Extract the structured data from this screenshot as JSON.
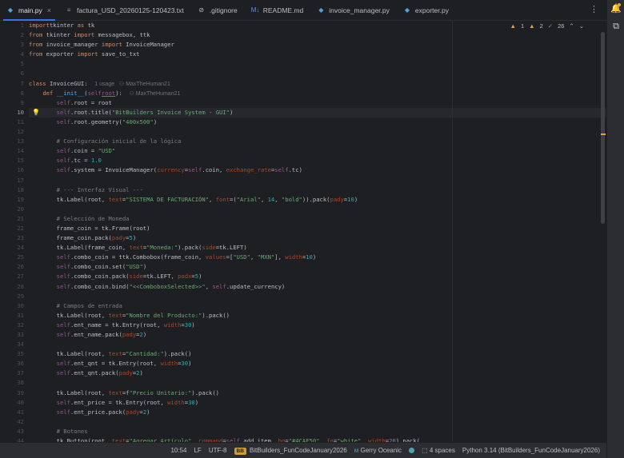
{
  "tabs": [
    {
      "icon": "python-file-icon",
      "glyph": "◆",
      "color": "#4aa3e0",
      "label": "main.py",
      "active": true,
      "closable": true
    },
    {
      "icon": "text-file-icon",
      "glyph": "≡",
      "color": "#8c8f94",
      "label": "factura_USD_20260125-120423.txt",
      "active": false,
      "closable": false
    },
    {
      "icon": "gitignore-icon",
      "glyph": "⊘",
      "color": "#bcbec4",
      "label": ".gitignore",
      "active": false,
      "closable": false
    },
    {
      "icon": "markdown-file-icon",
      "glyph": "M↓",
      "color": "#5b8ef0",
      "label": "README.md",
      "active": false,
      "closable": false
    },
    {
      "icon": "python-file-icon",
      "glyph": "◆",
      "color": "#4aa3e0",
      "label": "invoice_manager.py",
      "active": false,
      "closable": false
    },
    {
      "icon": "python-file-icon",
      "glyph": "◆",
      "color": "#4aa3e0",
      "label": "exporter.py",
      "active": false,
      "closable": false
    }
  ],
  "inspection": {
    "warnings": "1",
    "weak_warnings": "2",
    "ok": "26"
  },
  "current_line": 10,
  "code_lines": [
    [
      [
        "kw",
        "import"
      ],
      [
        "",
        "tkinter "
      ],
      [
        "kw",
        "as"
      ],
      [
        "",
        " tk"
      ]
    ],
    [
      [
        "kw",
        "from"
      ],
      [
        "",
        " tkinter "
      ],
      [
        "kw",
        "import"
      ],
      [
        "",
        " messagebox, ttk"
      ]
    ],
    [
      [
        "kw",
        "from"
      ],
      [
        "",
        " invoice_manager "
      ],
      [
        "kw",
        "import"
      ],
      [
        "",
        " InvoiceManager"
      ]
    ],
    [
      [
        "kw",
        "from"
      ],
      [
        "",
        " exporter "
      ],
      [
        "kw",
        "import"
      ],
      [
        "",
        " save_to_txt"
      ]
    ],
    [],
    [],
    [
      [
        "kw",
        "class"
      ],
      [
        "",
        " InvoiceGUI:  "
      ],
      [
        "hint",
        "1 usage   ⚇ MaxTheHuman21"
      ]
    ],
    [
      [
        "",
        "    "
      ],
      [
        "kw",
        "def"
      ],
      [
        "",
        " "
      ],
      [
        "fn",
        "__init__"
      ],
      [
        "",
        "("
      ],
      [
        "sf",
        "self"
      ],
      [
        ", "
      ],
      [
        "sf under",
        "root"
      ],
      [
        "",
        "):  "
      ],
      [
        "hint",
        "⚇ MaxTheHuman21"
      ]
    ],
    [
      [
        "",
        "        "
      ],
      [
        "sf",
        "self"
      ],
      [
        "",
        ".root = root"
      ]
    ],
    [
      [
        "",
        "        "
      ],
      [
        "sf",
        "self"
      ],
      [
        "",
        ".root.title("
      ],
      [
        "str",
        "\"BitBuilders Invoice System - GUI\""
      ],
      [
        "",
        ")"
      ]
    ],
    [
      [
        "",
        "        "
      ],
      [
        "sf",
        "self"
      ],
      [
        "",
        ".root.geometry("
      ],
      [
        "str",
        "\"400x500\""
      ],
      [
        "",
        ")"
      ]
    ],
    [],
    [
      [
        "",
        "        "
      ],
      [
        "cm",
        "# Configuración inicial de la lógica"
      ]
    ],
    [
      [
        "",
        "        "
      ],
      [
        "sf",
        "self"
      ],
      [
        "",
        ".coin = "
      ],
      [
        "str",
        "\"USD\""
      ]
    ],
    [
      [
        "",
        "        "
      ],
      [
        "sf",
        "self"
      ],
      [
        "",
        ".tc = "
      ],
      [
        "num",
        "1.0"
      ]
    ],
    [
      [
        "",
        "        "
      ],
      [
        "sf",
        "self"
      ],
      [
        "",
        ".system = InvoiceManager("
      ],
      [
        "kwarg",
        "currency"
      ],
      [
        "",
        "="
      ],
      [
        "sf",
        "self"
      ],
      [
        "",
        ".coin, "
      ],
      [
        "kwarg",
        "exchange_rate"
      ],
      [
        "",
        "="
      ],
      [
        "sf",
        "self"
      ],
      [
        "",
        ".tc)"
      ]
    ],
    [],
    [
      [
        "",
        "        "
      ],
      [
        "cm",
        "# --- Interfaz Visual ---"
      ]
    ],
    [
      [
        "",
        "        tk.Label(root, "
      ],
      [
        "kwarg",
        "text"
      ],
      [
        "",
        "="
      ],
      [
        "str",
        "\"SISTEMA DE FACTURACIÓN\""
      ],
      [
        "",
        ", "
      ],
      [
        "kwarg",
        "font"
      ],
      [
        "",
        "=("
      ],
      [
        "str",
        "\"Arial\""
      ],
      [
        "",
        ", "
      ],
      [
        "num",
        "14"
      ],
      [
        "",
        ", "
      ],
      [
        "str",
        "\"bold\""
      ],
      [
        "",
        "))"
      ],
      [
        "",
        ".pack("
      ],
      [
        "kwarg",
        "pady"
      ],
      [
        "",
        "="
      ],
      [
        "num",
        "10"
      ],
      [
        "",
        ")"
      ]
    ],
    [],
    [
      [
        "",
        "        "
      ],
      [
        "cm",
        "# Selección de Moneda"
      ]
    ],
    [
      [
        "",
        "        frame_coin = tk.Frame(root)"
      ]
    ],
    [
      [
        "",
        "        frame_coin.pack("
      ],
      [
        "kwarg",
        "pady"
      ],
      [
        "",
        "="
      ],
      [
        "num",
        "5"
      ],
      [
        "",
        ")"
      ]
    ],
    [
      [
        "",
        "        tk.Label(frame_coin, "
      ],
      [
        "kwarg",
        "text"
      ],
      [
        "",
        "="
      ],
      [
        "str",
        "\"Moneda:\""
      ],
      [
        "",
        ").pack("
      ],
      [
        "kwarg",
        "side"
      ],
      [
        "",
        "=tk.LEFT)"
      ]
    ],
    [
      [
        "",
        "        "
      ],
      [
        "sf",
        "self"
      ],
      [
        "",
        ".combo_coin = ttk.Combobox(frame_coin, "
      ],
      [
        "kwarg",
        "values"
      ],
      [
        "",
        "=["
      ],
      [
        "str",
        "\"USD\""
      ],
      [
        "",
        ", "
      ],
      [
        "str",
        "\"MXN\""
      ],
      [
        "",
        "], "
      ],
      [
        "kwarg",
        "width"
      ],
      [
        "",
        "="
      ],
      [
        "num",
        "10"
      ],
      [
        "",
        ")"
      ]
    ],
    [
      [
        "",
        "        "
      ],
      [
        "sf",
        "self"
      ],
      [
        "",
        ".combo_coin.set("
      ],
      [
        "str",
        "\"USD\""
      ],
      [
        "",
        ")"
      ]
    ],
    [
      [
        "",
        "        "
      ],
      [
        "sf",
        "self"
      ],
      [
        "",
        ".combo_coin.pack("
      ],
      [
        "kwarg",
        "side"
      ],
      [
        "",
        "=tk.LEFT, "
      ],
      [
        "kwarg",
        "padx"
      ],
      [
        "",
        "="
      ],
      [
        "num",
        "5"
      ],
      [
        "",
        ")"
      ]
    ],
    [
      [
        "",
        "        "
      ],
      [
        "sf",
        "self"
      ],
      [
        "",
        ".combo_coin.bind("
      ],
      [
        "str",
        "\"<<ComboboxSelected>>\""
      ],
      [
        "",
        ", "
      ],
      [
        "sf",
        "self"
      ],
      [
        "",
        ".update_currency)"
      ]
    ],
    [],
    [
      [
        "",
        "        "
      ],
      [
        "cm",
        "# Campos de entrada"
      ]
    ],
    [
      [
        "",
        "        tk.Label(root, "
      ],
      [
        "kwarg",
        "text"
      ],
      [
        "",
        "="
      ],
      [
        "str",
        "\"Nombre del Producto:\""
      ],
      [
        "",
        ").pack()"
      ]
    ],
    [
      [
        "",
        "        "
      ],
      [
        "sf",
        "self"
      ],
      [
        "",
        ".ent_name = tk.Entry(root, "
      ],
      [
        "kwarg",
        "width"
      ],
      [
        "",
        "="
      ],
      [
        "num",
        "30"
      ],
      [
        "",
        ")"
      ]
    ],
    [
      [
        "",
        "        "
      ],
      [
        "sf",
        "self"
      ],
      [
        "",
        ".ent_name.pack("
      ],
      [
        "kwarg",
        "pady"
      ],
      [
        "",
        "="
      ],
      [
        "num",
        "2"
      ],
      [
        "",
        ")"
      ]
    ],
    [],
    [
      [
        "",
        "        tk.Label(root, "
      ],
      [
        "kwarg",
        "text"
      ],
      [
        "",
        "="
      ],
      [
        "str",
        "\"Cantidad:\""
      ],
      [
        "",
        ").pack()"
      ]
    ],
    [
      [
        "",
        "        "
      ],
      [
        "sf",
        "self"
      ],
      [
        "",
        ".ent_qnt = tk.Entry(root, "
      ],
      [
        "kwarg",
        "width"
      ],
      [
        "",
        "="
      ],
      [
        "num",
        "30"
      ],
      [
        "",
        ")"
      ]
    ],
    [
      [
        "",
        "        "
      ],
      [
        "sf",
        "self"
      ],
      [
        "",
        ".ent_qnt.pack("
      ],
      [
        "kwarg",
        "pady"
      ],
      [
        "",
        "="
      ],
      [
        "num",
        "2"
      ],
      [
        "",
        ")"
      ]
    ],
    [],
    [
      [
        "",
        "        tk.Label(root, "
      ],
      [
        "kwarg",
        "text"
      ],
      [
        "",
        "=f"
      ],
      [
        "str",
        "\"Precio Unitario:\""
      ],
      [
        "",
        ").pack()"
      ]
    ],
    [
      [
        "",
        "        "
      ],
      [
        "sf",
        "self"
      ],
      [
        "",
        ".ent_price = tk.Entry(root, "
      ],
      [
        "kwarg",
        "width"
      ],
      [
        "",
        "="
      ],
      [
        "num",
        "30"
      ],
      [
        "",
        ")"
      ]
    ],
    [
      [
        "",
        "        "
      ],
      [
        "sf",
        "self"
      ],
      [
        "",
        ".ent_price.pack("
      ],
      [
        "kwarg",
        "pady"
      ],
      [
        "",
        "="
      ],
      [
        "num",
        "2"
      ],
      [
        "",
        ")"
      ]
    ],
    [],
    [
      [
        "",
        "        "
      ],
      [
        "cm",
        "# Botones"
      ]
    ],
    [
      [
        "",
        "        tk.Button(root, "
      ],
      [
        "kwarg",
        "text"
      ],
      [
        "",
        "="
      ],
      [
        "str",
        "\"Agregar Artículo\""
      ],
      [
        "",
        ", "
      ],
      [
        "kwarg",
        "command"
      ],
      [
        "",
        "="
      ],
      [
        "sf",
        "self"
      ],
      [
        "",
        ".add_item, "
      ],
      [
        "kwarg",
        "bg"
      ],
      [
        "",
        "="
      ],
      [
        "str",
        "\"#4CAF50\""
      ],
      [
        "",
        ", "
      ],
      [
        "kwarg",
        "fg"
      ],
      [
        "",
        "="
      ],
      [
        "str",
        "\"white\""
      ],
      [
        "",
        ", "
      ],
      [
        "kwarg",
        "width"
      ],
      [
        "",
        "="
      ],
      [
        "num",
        "20"
      ],
      [
        "",
        ").pack("
      ]
    ]
  ],
  "statusbar": {
    "position": "10:54",
    "line_sep": "LF",
    "encoding": "UTF-8",
    "project_badge": "BB",
    "project": "BitBuilders_FunCodeJanuary2026",
    "theme": "Gerry Oceanic",
    "indent": "4 spaces",
    "interpreter": "Python 3.14 (BitBuilders_FunCodeJanuary2026)"
  }
}
